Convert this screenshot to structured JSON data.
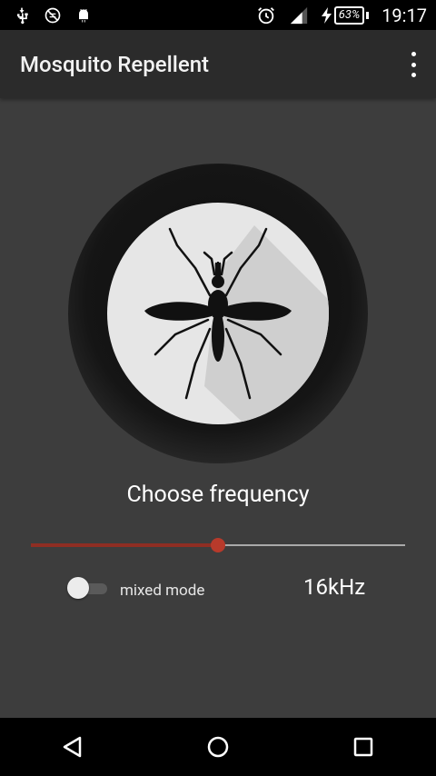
{
  "status_bar": {
    "icons_left": [
      "usb-icon",
      "ruler-off-icon",
      "android-icon"
    ],
    "icons_right": [
      "alarm-icon",
      "signal-icon",
      "charging-icon"
    ],
    "battery": "63%",
    "time": "19:17"
  },
  "app_bar": {
    "title": "Mosquito Repellent",
    "menu_icon": "overflow-menu-icon"
  },
  "main": {
    "mosquito_button_icon": "mosquito-icon",
    "choose_frequency_label": "Choose frequency",
    "frequency_slider": {
      "value_fraction": 0.5
    },
    "mixed_mode": {
      "label": "mixed mode",
      "enabled": false
    },
    "frequency_value": "16kHz"
  },
  "nav_bar": {
    "back_icon": "back-icon",
    "home_icon": "home-icon",
    "recents_icon": "recents-icon"
  },
  "colors": {
    "background": "#3d3d3d",
    "app_bar": "#2b2b2b",
    "accent": "#b73a2b"
  }
}
